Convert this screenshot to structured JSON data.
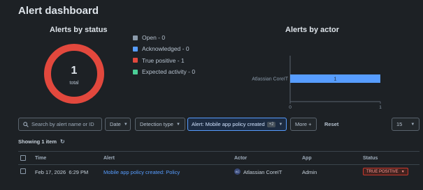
{
  "title": "Alert dashboard",
  "status_section": {
    "title": "Alerts by status",
    "donut": {
      "value": "1",
      "sub": "total"
    },
    "legend": [
      {
        "label": "Open - 0",
        "color": "#8c9bab"
      },
      {
        "label": "Acknowledged - 0",
        "color": "#579dff"
      },
      {
        "label": "True positive - 1",
        "color": "#e2483d"
      },
      {
        "label": "Expected activity - 0",
        "color": "#4bce97"
      }
    ]
  },
  "chart_data": {
    "type": "bar",
    "title": "Alerts by actor",
    "orientation": "horizontal",
    "categories": [
      "Atlassian CoreIT"
    ],
    "values": [
      1
    ],
    "xlim": [
      0,
      1
    ],
    "xticks": [
      "0",
      "1"
    ],
    "data_labels": [
      "1"
    ],
    "color": "#579dff"
  },
  "filters": {
    "search_placeholder": "Search by alert name or ID",
    "date": "Date",
    "detection_type": "Detection type",
    "alert_filter": "Alert: Mobile app policy created",
    "alert_filter_badge": "+2",
    "more": "More +",
    "reset": "Reset",
    "page_size": "15"
  },
  "showing": "Showing 1 item",
  "table": {
    "headers": [
      "Time",
      "Alert",
      "Actor",
      "App",
      "Status"
    ],
    "rows": [
      {
        "time": "Feb 17, 2026  6:29 PM",
        "alert": "Mobile app policy created: Policy",
        "actor_initials": "AC",
        "actor": "Atlassian CoreIT",
        "app": "Admin",
        "status": "TRUE POSITIVE"
      }
    ]
  }
}
